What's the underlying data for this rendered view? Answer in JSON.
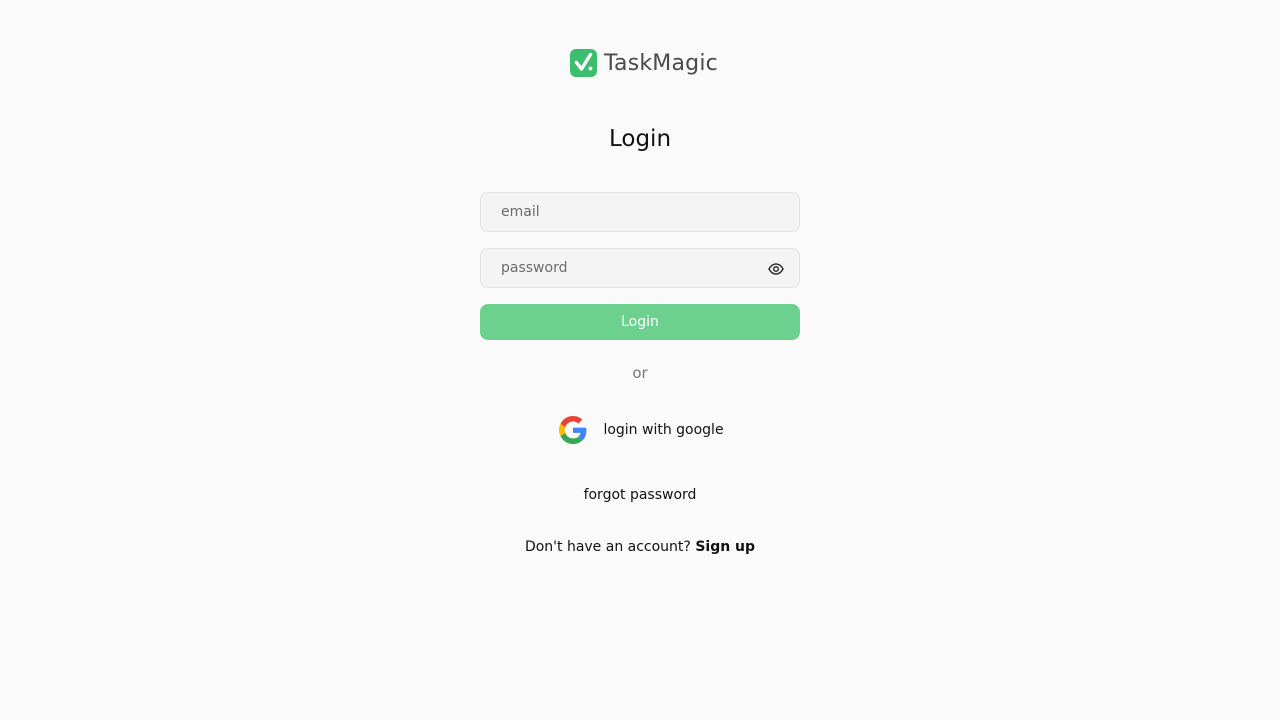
{
  "brand": {
    "name": "TaskMagic",
    "logo_icon": "check-badge-icon",
    "accent": "#3bbf6e"
  },
  "title": "Login",
  "form": {
    "email_placeholder": "email",
    "email_value": "",
    "password_placeholder": "password",
    "password_value": "",
    "password_toggle_icon": "eye-icon",
    "submit_label": "Login",
    "submit_color": "#6cd08f"
  },
  "divider_text": "or",
  "google": {
    "icon": "google-icon",
    "label": "login with google"
  },
  "forgot_password": "forgot password",
  "signup": {
    "prompt": "Don't have an account?",
    "link": "Sign up"
  }
}
